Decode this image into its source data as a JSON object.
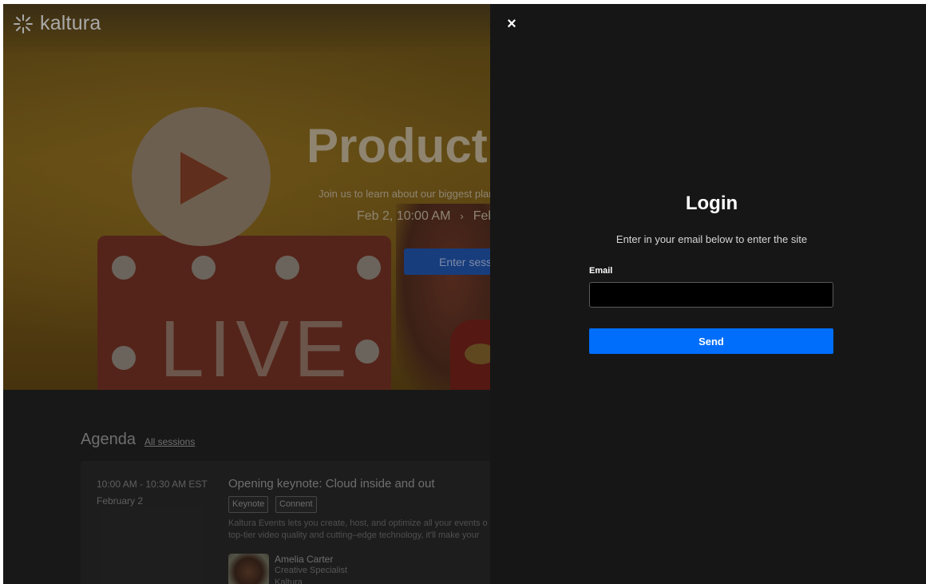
{
  "app": {
    "logo_text": "kaltura"
  },
  "hero": {
    "title": "Product l",
    "subtitle": "Join us to learn about our biggest plar",
    "date_start": "Feb 2, 10:00 AM",
    "date_arrow": "›",
    "date_end": "Feb",
    "enter_button_label": "Enter sessi",
    "live_sign_text": "LIVE"
  },
  "agenda": {
    "title": "Agenda",
    "all_sessions_link": "All sessions",
    "sessions": [
      {
        "time": "10:00 AM - 10:30 AM EST",
        "date": "February 2",
        "title": "Opening keynote: Cloud inside and out",
        "tags": [
          "Keynote",
          "Connent"
        ],
        "description_line1": "Kaltura Events lets you create, host, and optimize all your events o",
        "description_line2": "top-tier video quality and cutting–edge technology, it'll make your",
        "speaker": {
          "name": "Amelia Carter",
          "role": "Creative Specialist",
          "org": "Kaltura"
        }
      }
    ]
  },
  "login": {
    "close_icon": "×",
    "title": "Login",
    "subtitle": "Enter in your email below to enter the site",
    "email_label": "Email",
    "email_value": "",
    "email_placeholder": "",
    "send_label": "Send"
  },
  "colors": {
    "drawer_bg": "#161616",
    "send_button": "#006efa",
    "page_bg": "#1f1f1f"
  }
}
